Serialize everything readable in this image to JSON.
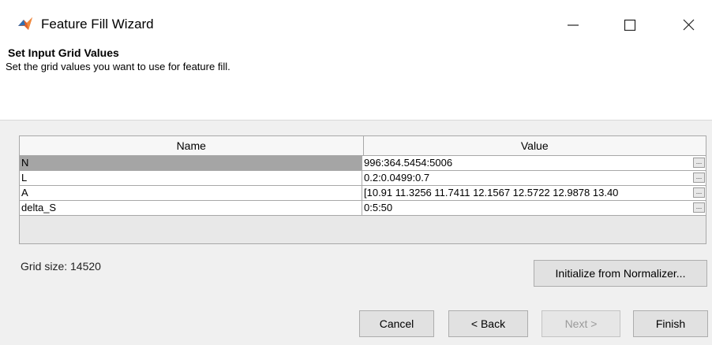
{
  "window": {
    "title": "Feature Fill Wizard",
    "icon": "matlab-icon",
    "controls": [
      "minimize-icon",
      "maximize-icon",
      "close-icon"
    ]
  },
  "header": {
    "title": "Set Input Grid Values",
    "description": "Set the grid values you want to use for feature fill."
  },
  "grid": {
    "columns": {
      "name": "Name",
      "value": "Value"
    },
    "selected_row": "N",
    "rows": [
      {
        "name": "N",
        "value": "996:364.5454:5006",
        "edit": "..."
      },
      {
        "name": "L",
        "value": "0.2:0.0499:0.7",
        "edit": "..."
      },
      {
        "name": "A",
        "value": "[10.91 11.3256 11.7411 12.1567 12.5722 12.9878 13.40",
        "edit": "..."
      },
      {
        "name": "delta_S",
        "value": "0:5:50",
        "edit": "..."
      }
    ]
  },
  "status": {
    "grid_size": "Grid size: 14520"
  },
  "buttons": {
    "initialize": "Initialize from Normalizer...",
    "cancel": "Cancel",
    "back": "< Back",
    "next": "Next >",
    "finish": "Finish"
  },
  "colors": {
    "selected_row": "#a5a5a5",
    "dialog_bg": "#f0f0f0",
    "disabled_text": "#9a9a9a"
  }
}
